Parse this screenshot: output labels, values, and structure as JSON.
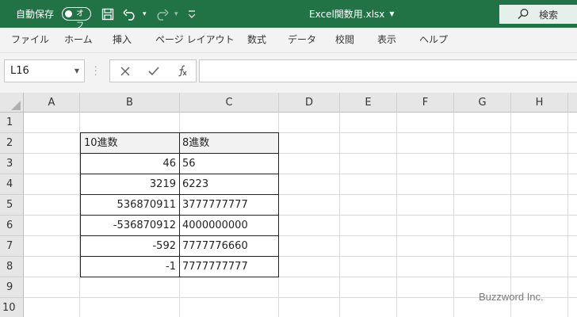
{
  "titlebar": {
    "autosave_label": "自動保存",
    "autosave_toggle_text": "オフ",
    "filename": "Excel関数用.xlsx",
    "search_label": "検索"
  },
  "ribbon": {
    "tabs": [
      "ファイル",
      "ホーム",
      "挿入",
      "ページ レイアウト",
      "数式",
      "データ",
      "校閲",
      "表示",
      "ヘルプ"
    ]
  },
  "formula_bar": {
    "name_box": "L16",
    "formula": ""
  },
  "grid": {
    "columns": [
      "A",
      "B",
      "C",
      "D",
      "E",
      "F",
      "G",
      "H"
    ],
    "rows": [
      "1",
      "2",
      "3",
      "4",
      "5",
      "6",
      "7",
      "8",
      "9",
      "10"
    ],
    "table": {
      "header": {
        "b": "10進数",
        "c": "8進数"
      },
      "rows": [
        {
          "b": "46",
          "c": "56"
        },
        {
          "b": "3219",
          "c": "6223"
        },
        {
          "b": "536870911",
          "c": "3777777777"
        },
        {
          "b": "-536870912",
          "c": "4000000000"
        },
        {
          "b": "-592",
          "c": "7777776660"
        },
        {
          "b": "-1",
          "c": "7777777777"
        }
      ]
    }
  },
  "watermark": "Buzzword Inc.",
  "colors": {
    "titlebar": "#217346",
    "ribbon": "#f3f3f3",
    "header_fill": "#e6e6e6"
  }
}
